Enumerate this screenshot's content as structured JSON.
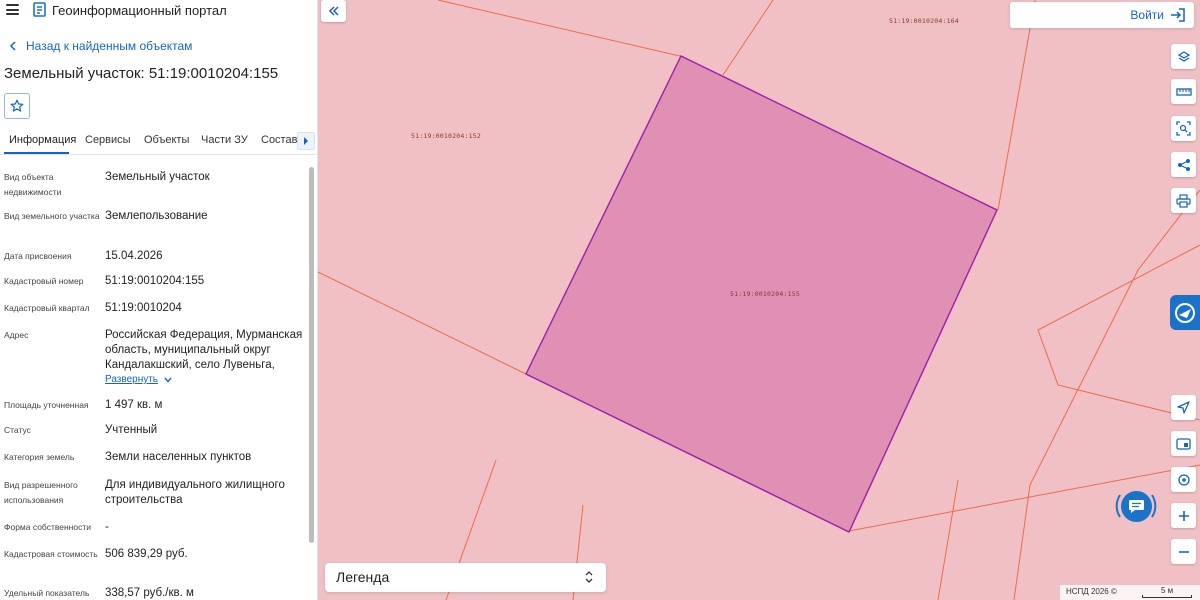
{
  "app": {
    "title": "Геоинформационный портал"
  },
  "panel": {
    "back_label": "Назад к найденным объектам",
    "object_title": "Земельный участок: 51:19:0010204:155",
    "tabs": [
      "Информация",
      "Сервисы",
      "Объекты",
      "Части ЗУ",
      "Состав"
    ],
    "active_tab": "Информация",
    "fields": [
      {
        "label": "Вид объекта недвижимости",
        "value": "Земельный участок"
      },
      {
        "label": "Вид земельного участка",
        "value": "Землепользование"
      },
      {
        "label": "Дата присвоения",
        "value": "15.04.2026"
      },
      {
        "label": "Кадастровый номер",
        "value": "51:19:0010204:155"
      },
      {
        "label": "Кадастровый квартал",
        "value": "51:19:0010204"
      },
      {
        "label": "Адрес",
        "value": "Российская Федерация, Мурманская область, муниципальный округ Кандалакшский, село Лувеньга,"
      },
      {
        "label": "Площадь уточненная",
        "value": "1 497 кв. м"
      },
      {
        "label": "Статус",
        "value": "Учтенный"
      },
      {
        "label": "Категория земель",
        "value": "Земли населенных пунктов"
      },
      {
        "label": "Вид разрешенного использования",
        "value": "Для индивидуального жилищного строительства"
      },
      {
        "label": "Форма собственности",
        "value": "-"
      },
      {
        "label": "Кадастровая стоимость",
        "value": "506 839,29 руб."
      },
      {
        "label": "Удельный показатель",
        "value": "338,57 руб./кв. м"
      }
    ],
    "expand_label": "Развернуть"
  },
  "map": {
    "parcel_labels": {
      "main": "51:19:0010204:155",
      "left": "51:19:0010204:152",
      "top": "51:19:0010204:164"
    },
    "login_label": "Войти",
    "legend_label": "Легенда",
    "attribution": "НСПД 2026 ©",
    "scale_label": "5 м",
    "colors": {
      "background": "#f0c0c5",
      "selected_fill": "#e090b2",
      "selected_stroke": "#9c1fb0",
      "boundary_lines": "#ef6b4a",
      "accent": "#1565c0"
    },
    "tools": [
      "layers-icon",
      "ruler-icon",
      "area-select-icon",
      "share-icon",
      "print-icon",
      "navigate-icon",
      "minimap-icon",
      "location-icon",
      "zoom-in-icon",
      "zoom-out-icon"
    ]
  }
}
